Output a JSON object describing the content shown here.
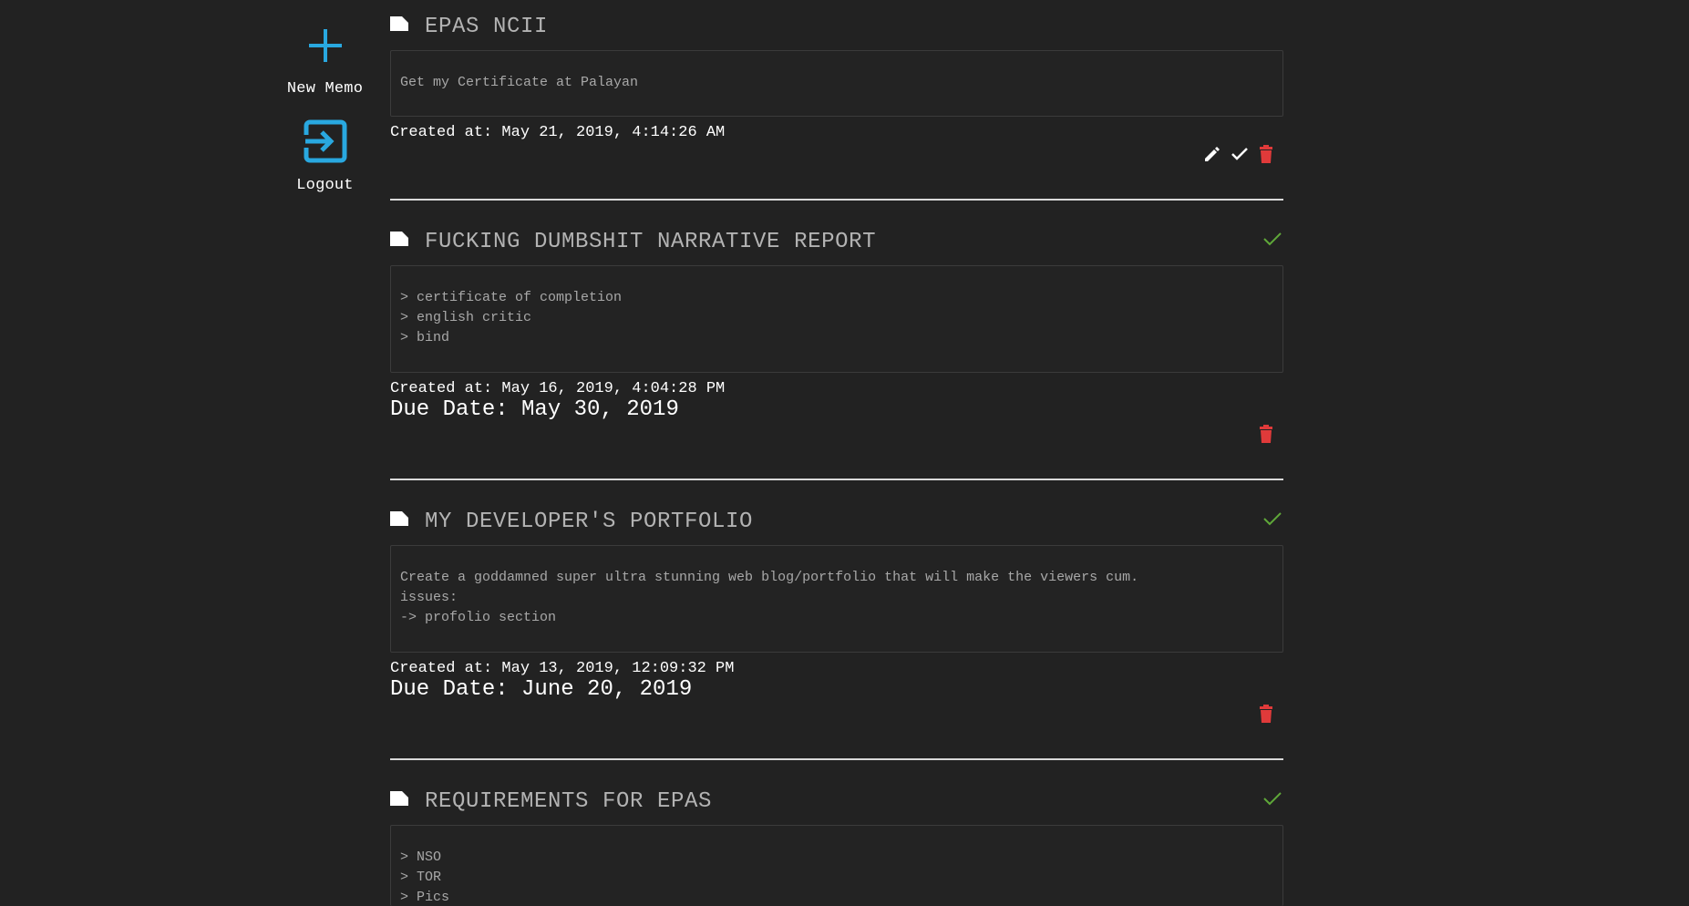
{
  "sidebar": {
    "new_memo_label": "New Memo",
    "logout_label": "Logout",
    "accent": "#29a8e0"
  },
  "colors": {
    "background": "#222222",
    "check_green": "#5fa839",
    "trash_red": "#e03a3a"
  },
  "memos": [
    {
      "title": "EPAS NCII",
      "body": "Get my Certificate at Palayan",
      "created": "Created at: May 21, 2019, 4:14:26 AM",
      "due": "",
      "done": false
    },
    {
      "title": "FUCKING DUMBSHIT NARRATIVE REPORT",
      "body": "> certificate of completion\n> english critic\n> bind",
      "created": "Created at: May 16, 2019, 4:04:28 PM",
      "due": "Due Date: May 30, 2019",
      "done": true
    },
    {
      "title": "MY DEVELOPER'S PORTFOLIO",
      "body": "Create a goddamned super ultra stunning web blog/portfolio that will make the viewers cum.\nissues:\n-> profolio section",
      "created": "Created at: May 13, 2019, 12:09:32 PM",
      "due": "Due Date: June 20, 2019",
      "done": true
    },
    {
      "title": "REQUIREMENTS FOR EPAS",
      "body": "> NSO\n> TOR\n> Pics",
      "created": "",
      "due": "",
      "done": true
    }
  ]
}
